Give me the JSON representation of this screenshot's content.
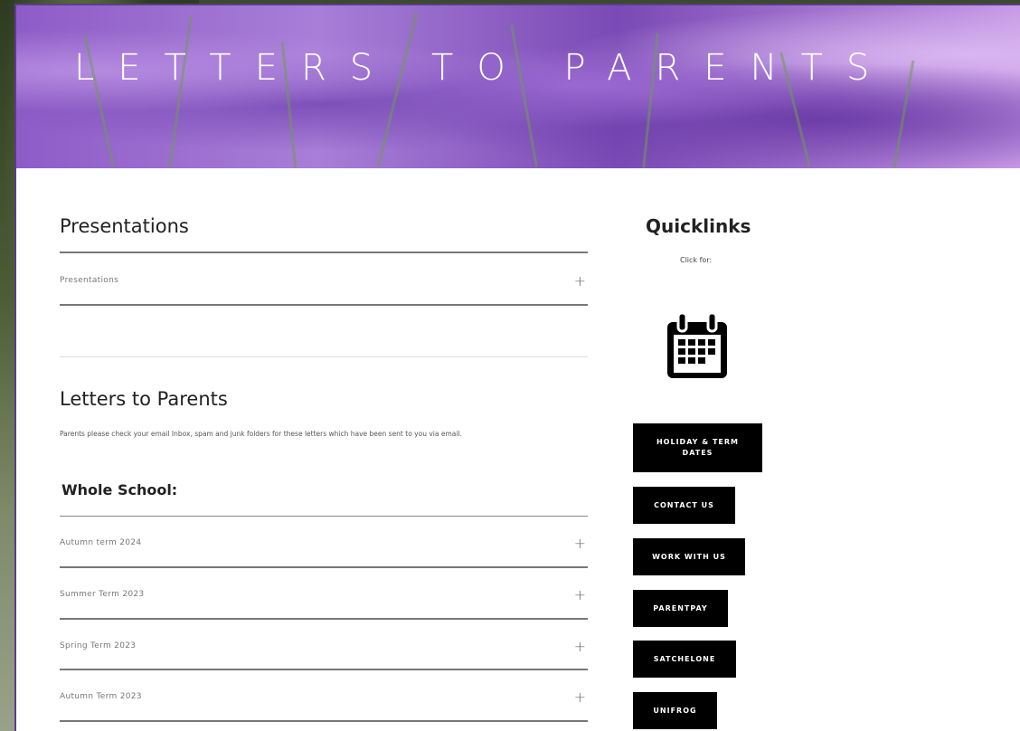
{
  "hero": {
    "title": "LETTERS TO PARENTS"
  },
  "presentations": {
    "title": "Presentations",
    "items": [
      {
        "label": "Presentations"
      }
    ]
  },
  "letters": {
    "title": "Letters to Parents",
    "intro": "Parents please check your email Inbox, spam and junk folders for these letters which have been sent to you via email.",
    "group_title": "Whole School:",
    "items": [
      {
        "label": "Autumn term 2024"
      },
      {
        "label": "Summer Term 2023"
      },
      {
        "label": "Spring Term 2023"
      },
      {
        "label": "Autumn Term 2023"
      }
    ]
  },
  "quicklinks": {
    "title": "Quicklinks",
    "subtitle": "Click for:",
    "icon": "calendar-icon",
    "buttons": [
      {
        "label": "HOLIDAY & TERM DATES"
      },
      {
        "label": "CONTACT US"
      },
      {
        "label": "WORK WITH US"
      },
      {
        "label": "PARENTPAY"
      },
      {
        "label": "SATCHELONE"
      },
      {
        "label": "UNIFROG"
      }
    ]
  },
  "colors": {
    "accent": "#5a3d8a",
    "button_bg": "#000000",
    "hero_purple": "#8e5cc7"
  }
}
